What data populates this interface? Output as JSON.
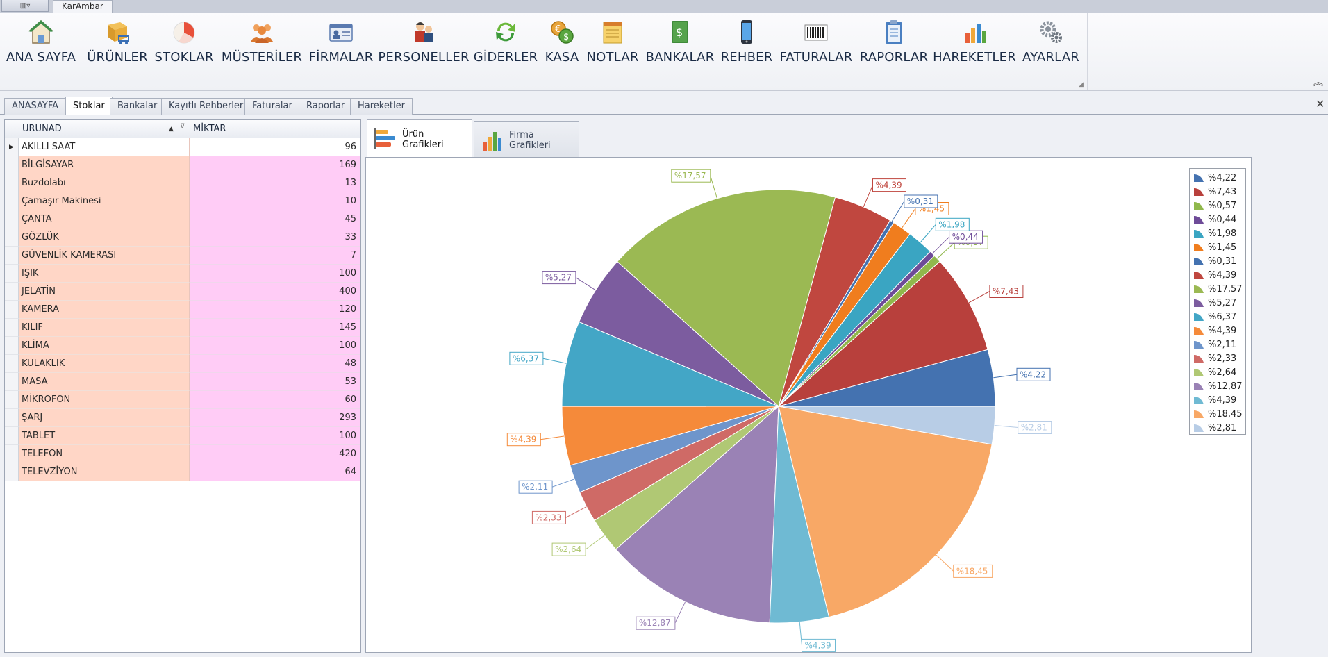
{
  "window": {
    "menu_button_glyph": "▥▿",
    "document_tab": "KarAmbar"
  },
  "ribbon": {
    "buttons": [
      {
        "label": "ANA SAYFA",
        "icon": "house-icon"
      },
      {
        "label": "ÜRÜNLER",
        "icon": "box-cart-icon"
      },
      {
        "label": "STOKLAR",
        "icon": "pie-chart-icon"
      },
      {
        "label": "MÜSTERİLER",
        "icon": "users-group-icon"
      },
      {
        "label": "FİRMALAR",
        "icon": "id-card-icon"
      },
      {
        "label": "PERSONELLER",
        "icon": "worker-icon"
      },
      {
        "label": "GİDERLER",
        "icon": "refresh-icon"
      },
      {
        "label": "KASA",
        "icon": "coins-icon"
      },
      {
        "label": "NOTLAR",
        "icon": "notepad-icon"
      },
      {
        "label": "BANKALAR",
        "icon": "money-book-icon"
      },
      {
        "label": "REHBER",
        "icon": "phone-icon"
      },
      {
        "label": "FATURALAR",
        "icon": "barcode-icon"
      },
      {
        "label": "RAPORLAR",
        "icon": "clipboard-icon"
      },
      {
        "label": "HAREKETLER",
        "icon": "bar-chart-icon"
      },
      {
        "label": "AYARLAR",
        "icon": "gears-icon"
      }
    ],
    "launcher_glyph": "◢",
    "collapse_glyph": "︽"
  },
  "tabs": [
    {
      "label": "ANASAYFA"
    },
    {
      "label": "Stoklar"
    },
    {
      "label": "Bankalar"
    },
    {
      "label": "Kayıtlı Rehberler"
    },
    {
      "label": "Faturalar"
    },
    {
      "label": "Raporlar"
    },
    {
      "label": "Hareketler"
    }
  ],
  "active_tab": "Stoklar",
  "close_glyph": "✕",
  "grid": {
    "columns": [
      "URUNAD",
      "MİKTAR"
    ],
    "sort_glyph": "▲",
    "filter_glyph": "⊽",
    "current_row_glyph": "▶",
    "rows": [
      [
        "AKILLI SAAT",
        "96"
      ],
      [
        "BİLGİSAYAR",
        "169"
      ],
      [
        "Buzdolabı",
        "13"
      ],
      [
        "Çamaşır Makinesi",
        "10"
      ],
      [
        "ÇANTA",
        "45"
      ],
      [
        "GÖZLÜK",
        "33"
      ],
      [
        "GÜVENLİK KAMERASI",
        "7"
      ],
      [
        "IŞIK",
        "100"
      ],
      [
        "JELATİN",
        "400"
      ],
      [
        "KAMERA",
        "120"
      ],
      [
        "KILIF",
        "145"
      ],
      [
        "KLİMA",
        "100"
      ],
      [
        "KULAKLIK",
        "48"
      ],
      [
        "MASA",
        "53"
      ],
      [
        "MİKROFON",
        "60"
      ],
      [
        "ŞARJ",
        "293"
      ],
      [
        "TABLET",
        "100"
      ],
      [
        "TELEFON",
        "420"
      ],
      [
        "TELEVZİYON",
        "64"
      ]
    ]
  },
  "chart_tabs": [
    {
      "label": "Ürün Grafikleri",
      "icon": "horizontal-bars-icon"
    },
    {
      "label": "Firma Grafikleri",
      "icon": "vertical-bars-icon"
    }
  ],
  "chart_data": {
    "type": "pie",
    "title": "",
    "slices": [
      {
        "label": "%4,22",
        "value": 4.22,
        "color": "#4472b0"
      },
      {
        "label": "%7,43",
        "value": 7.43,
        "color": "#b8403c"
      },
      {
        "label": "%0,57",
        "value": 0.57,
        "color": "#90b84c"
      },
      {
        "label": "%0,44",
        "value": 0.44,
        "color": "#6e4b98"
      },
      {
        "label": "%1,98",
        "value": 1.98,
        "color": "#3aa5c2"
      },
      {
        "label": "%1,45",
        "value": 1.45,
        "color": "#f07d1e"
      },
      {
        "label": "%0,31",
        "value": 0.31,
        "color": "#4472b0"
      },
      {
        "label": "%4,39",
        "value": 4.39,
        "color": "#c0473f"
      },
      {
        "label": "%17,57",
        "value": 17.57,
        "color": "#9bb953"
      },
      {
        "label": "%5,27",
        "value": 5.27,
        "color": "#7c5c9f"
      },
      {
        "label": "%6,37",
        "value": 6.37,
        "color": "#43a6c6"
      },
      {
        "label": "%4,39",
        "value": 4.39,
        "color": "#f58a3a"
      },
      {
        "label": "%2,11",
        "value": 2.11,
        "color": "#6e95cb"
      },
      {
        "label": "%2,33",
        "value": 2.33,
        "color": "#cf6a66"
      },
      {
        "label": "%2,64",
        "value": 2.64,
        "color": "#b0c874"
      },
      {
        "label": "%12,87",
        "value": 12.87,
        "color": "#9a82b5"
      },
      {
        "label": "%4,39",
        "value": 4.39,
        "color": "#6fbad3"
      },
      {
        "label": "%18,45",
        "value": 18.45,
        "color": "#f8a866"
      },
      {
        "label": "%2,81",
        "value": 2.81,
        "color": "#b8cde6"
      }
    ],
    "legend_position": "top-right"
  }
}
